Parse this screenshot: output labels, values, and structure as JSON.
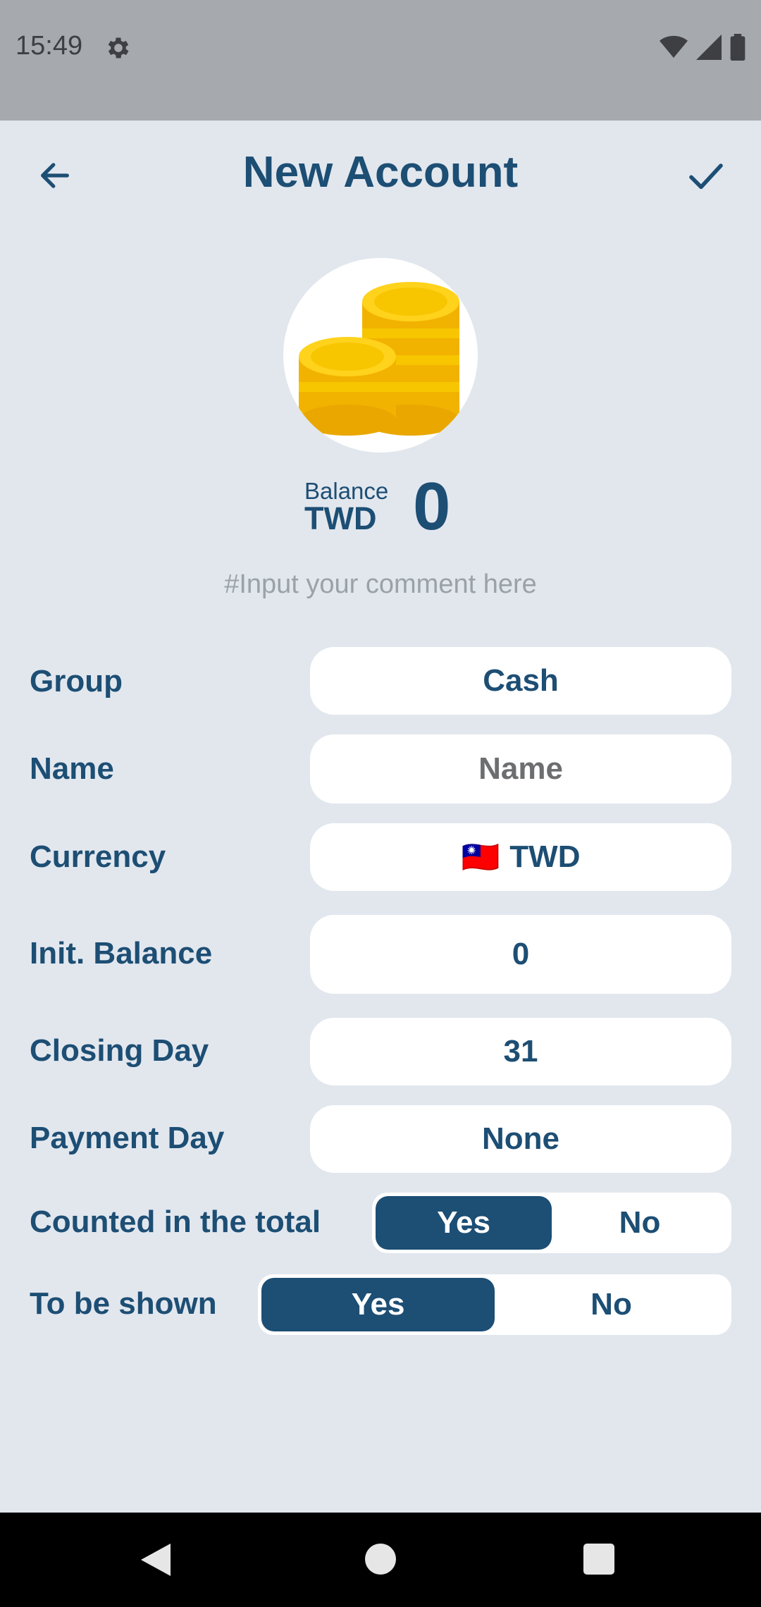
{
  "status": {
    "time": "15:49"
  },
  "appbar": {
    "title": "New Account"
  },
  "balance": {
    "label": "Balance",
    "currency": "TWD",
    "amount": "0"
  },
  "comment": {
    "placeholder": "#Input your comment here"
  },
  "form": {
    "group": {
      "label": "Group",
      "value": "Cash"
    },
    "name": {
      "label": "Name",
      "placeholder": "Name"
    },
    "currency": {
      "label": "Currency",
      "flag": "🇹🇼",
      "value": "TWD"
    },
    "init_balance": {
      "label": "Init. Balance",
      "value": "0"
    },
    "closing_day": {
      "label": "Closing Day",
      "value": "31"
    },
    "payment_day": {
      "label": "Payment Day",
      "value": "None"
    },
    "counted": {
      "label": "Counted in the total",
      "yes": "Yes",
      "no": "No",
      "selected": "Yes"
    },
    "shown": {
      "label": "To be shown",
      "yes": "Yes",
      "no": "No",
      "selected": "Yes"
    }
  },
  "colors": {
    "accent": "#1d4e74",
    "background": "#e2e7ee",
    "coin": "#f7c600"
  }
}
